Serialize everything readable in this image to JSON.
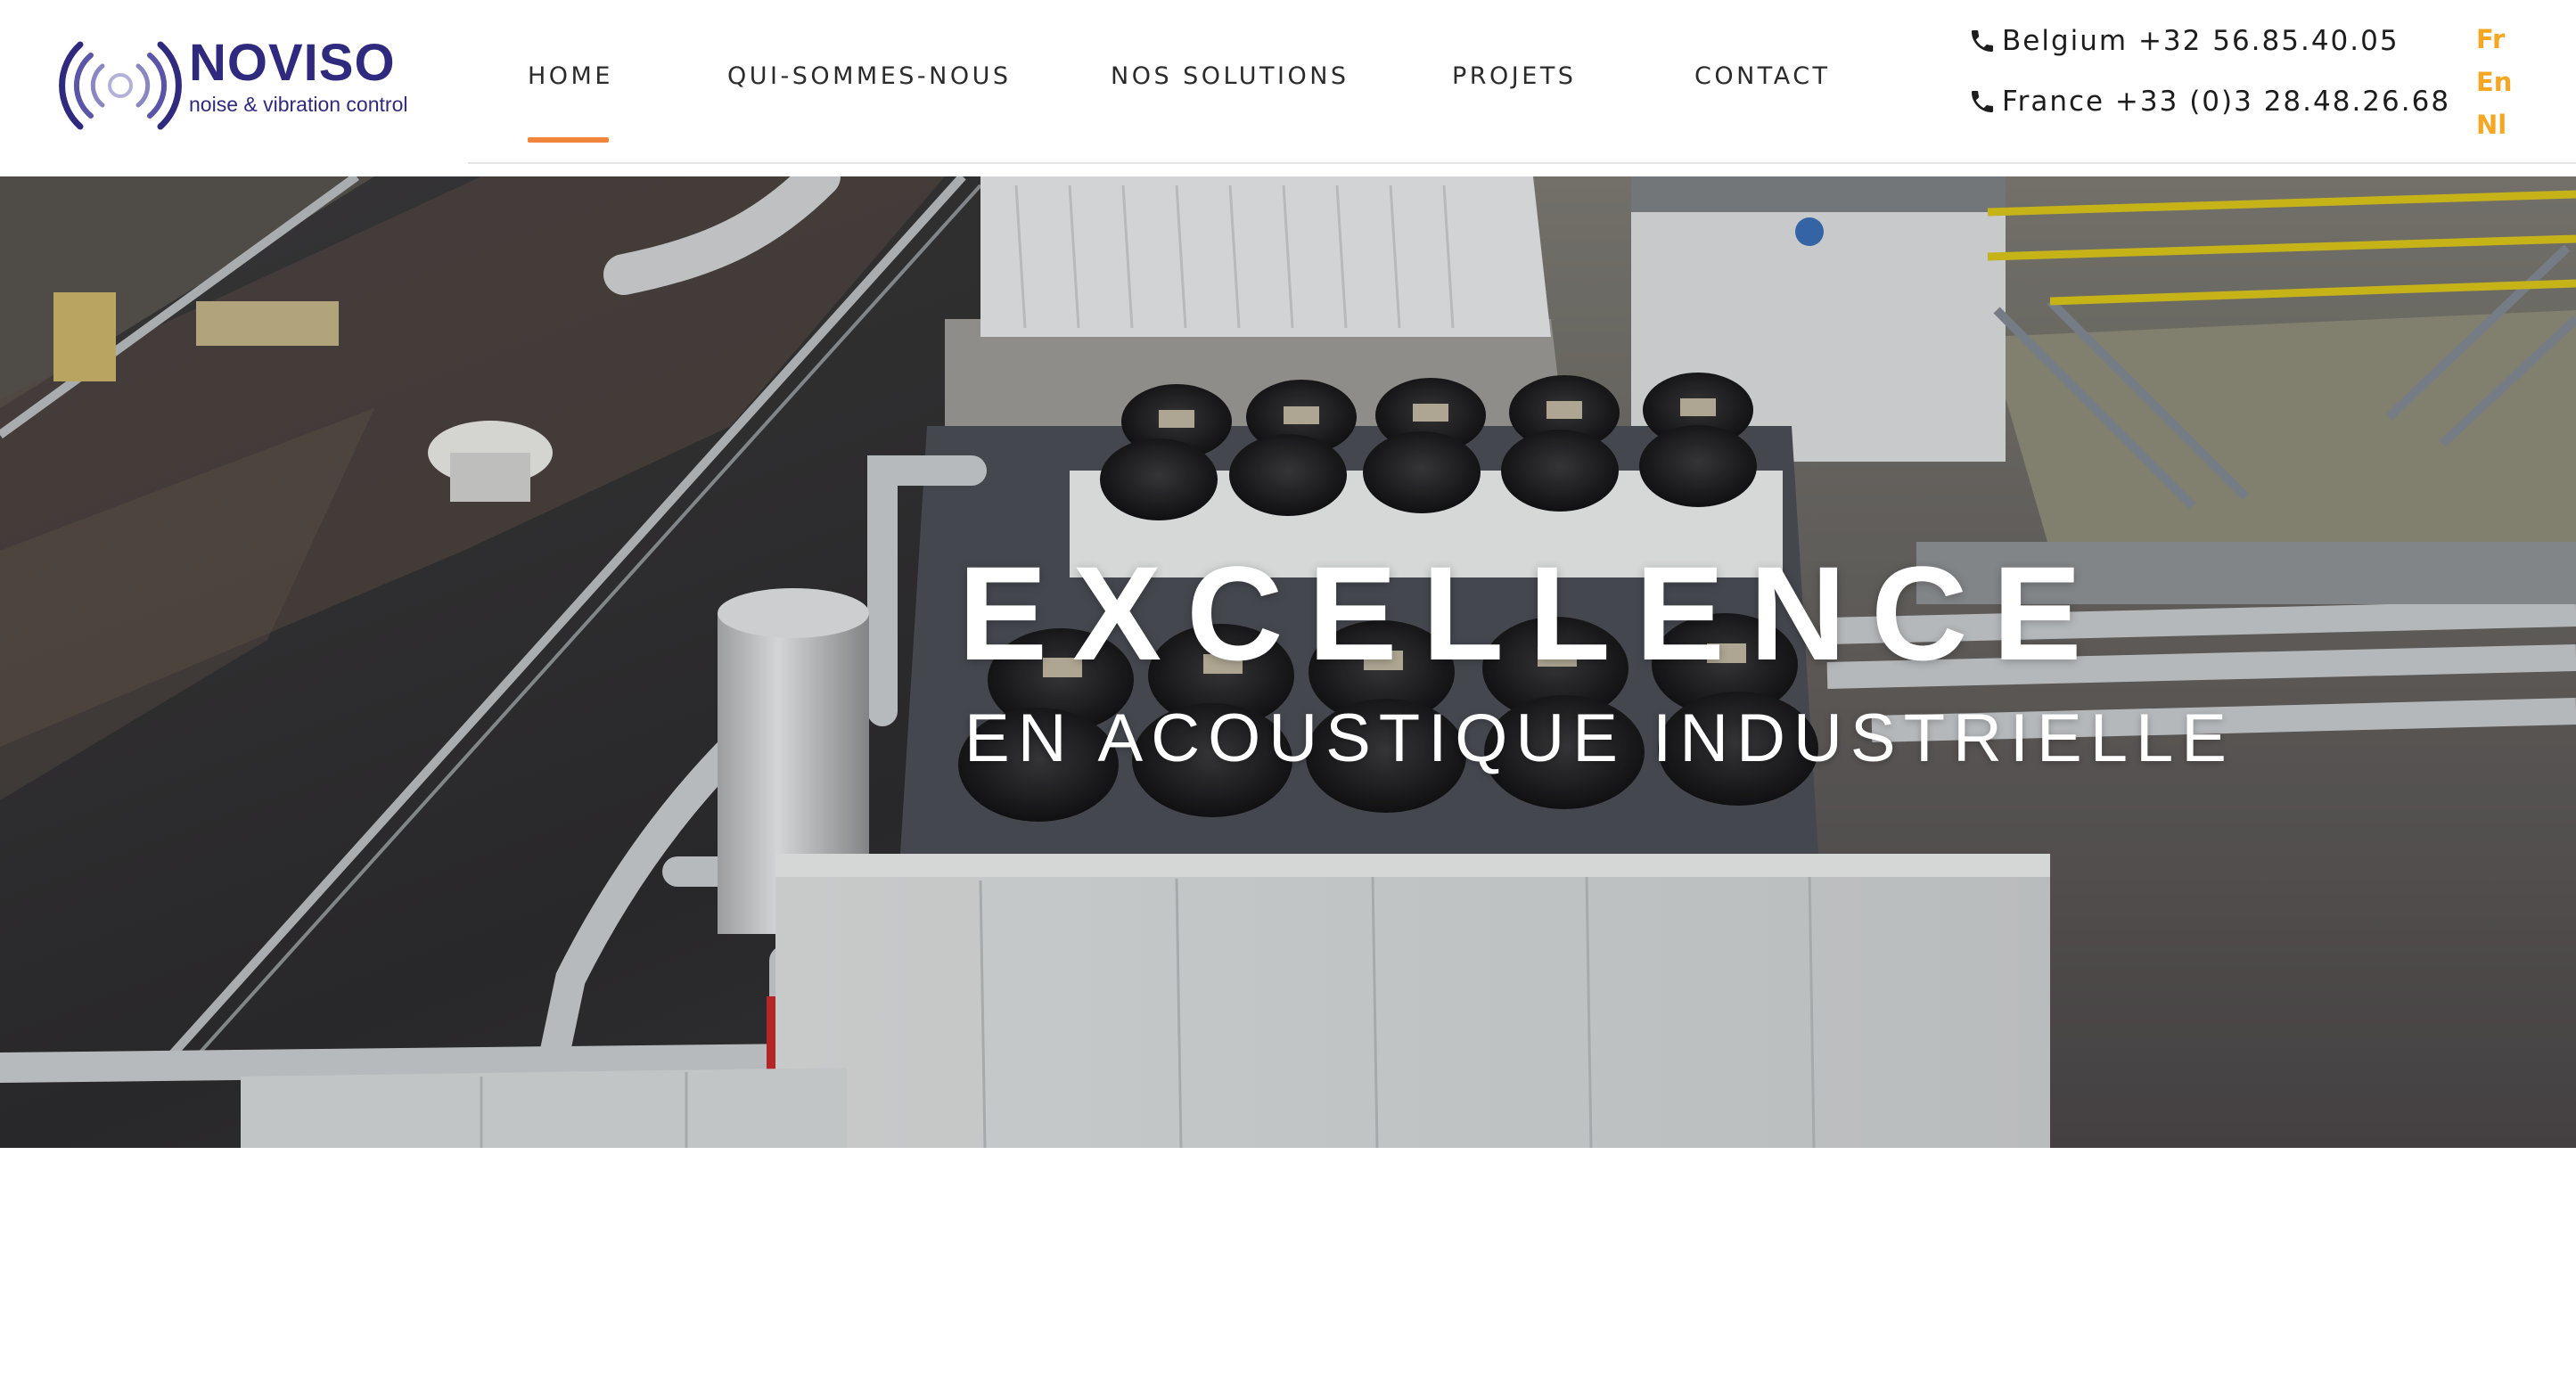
{
  "brand": {
    "name": "NOVISO",
    "tagline": "noise & vibration control",
    "color": "#2f2a7e"
  },
  "nav": {
    "items": [
      {
        "label": "HOME",
        "active": true
      },
      {
        "label": "QUI-SOMMES-NOUS",
        "active": false
      },
      {
        "label": "NOS SOLUTIONS",
        "active": false
      },
      {
        "label": "PROJETS",
        "active": false
      },
      {
        "label": "CONTACT",
        "active": false
      }
    ],
    "active_color": "#f0853b"
  },
  "contact": {
    "phones": [
      {
        "icon": "phone-icon",
        "label": "Belgium +32 56.85.40.05"
      },
      {
        "icon": "phone-icon",
        "label": "France +33 (0)3 28.48.26.68"
      }
    ]
  },
  "languages": {
    "items": [
      "Fr",
      "En",
      "Nl"
    ],
    "color": "#f5a623"
  },
  "hero": {
    "title": "EXCELLENCE",
    "subtitle": "EN ACOUSTIQUE INDUSTRIELLE"
  }
}
